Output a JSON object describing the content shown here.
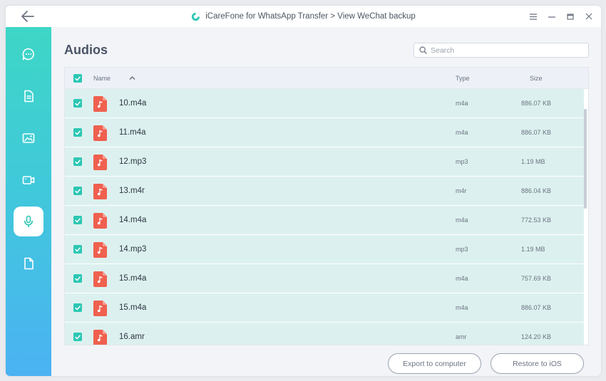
{
  "window": {
    "title": "iCareFone for WhatsApp Transfer > View WeChat backup"
  },
  "sidebar": {
    "items": [
      {
        "icon": "chat-icon",
        "active": false
      },
      {
        "icon": "document-icon",
        "active": false
      },
      {
        "icon": "image-icon",
        "active": false
      },
      {
        "icon": "video-icon",
        "active": false
      },
      {
        "icon": "microphone-icon",
        "active": true
      },
      {
        "icon": "file-icon",
        "active": false
      }
    ]
  },
  "main": {
    "title": "Audios",
    "search": {
      "placeholder": "Search",
      "value": ""
    }
  },
  "table": {
    "columns": {
      "name": "Name",
      "type": "Type",
      "size": "Size"
    },
    "rows": [
      {
        "name": "10.m4a",
        "type": "m4a",
        "size": "886.07 KB"
      },
      {
        "name": "11.m4a",
        "type": "m4a",
        "size": "886.07 KB"
      },
      {
        "name": "12.mp3",
        "type": "mp3",
        "size": "1.19 MB"
      },
      {
        "name": "13.m4r",
        "type": "m4r",
        "size": "886.04 KB"
      },
      {
        "name": "14.m4a",
        "type": "m4a",
        "size": "772.53 KB"
      },
      {
        "name": "14.mp3",
        "type": "mp3",
        "size": "1.19 MB"
      },
      {
        "name": "15.m4a",
        "type": "m4a",
        "size": "757.69 KB"
      },
      {
        "name": "15.m4a",
        "type": "m4a",
        "size": "886.07 KB"
      },
      {
        "name": "16.amr",
        "type": "amr",
        "size": "124.20 KB"
      }
    ]
  },
  "footer": {
    "export_label": "Export to computer",
    "restore_label": "Restore to iOS"
  },
  "colors": {
    "accent": "#2cc7b4",
    "row_selected": "#dcf1ef",
    "file_icon": "#f0604f"
  }
}
